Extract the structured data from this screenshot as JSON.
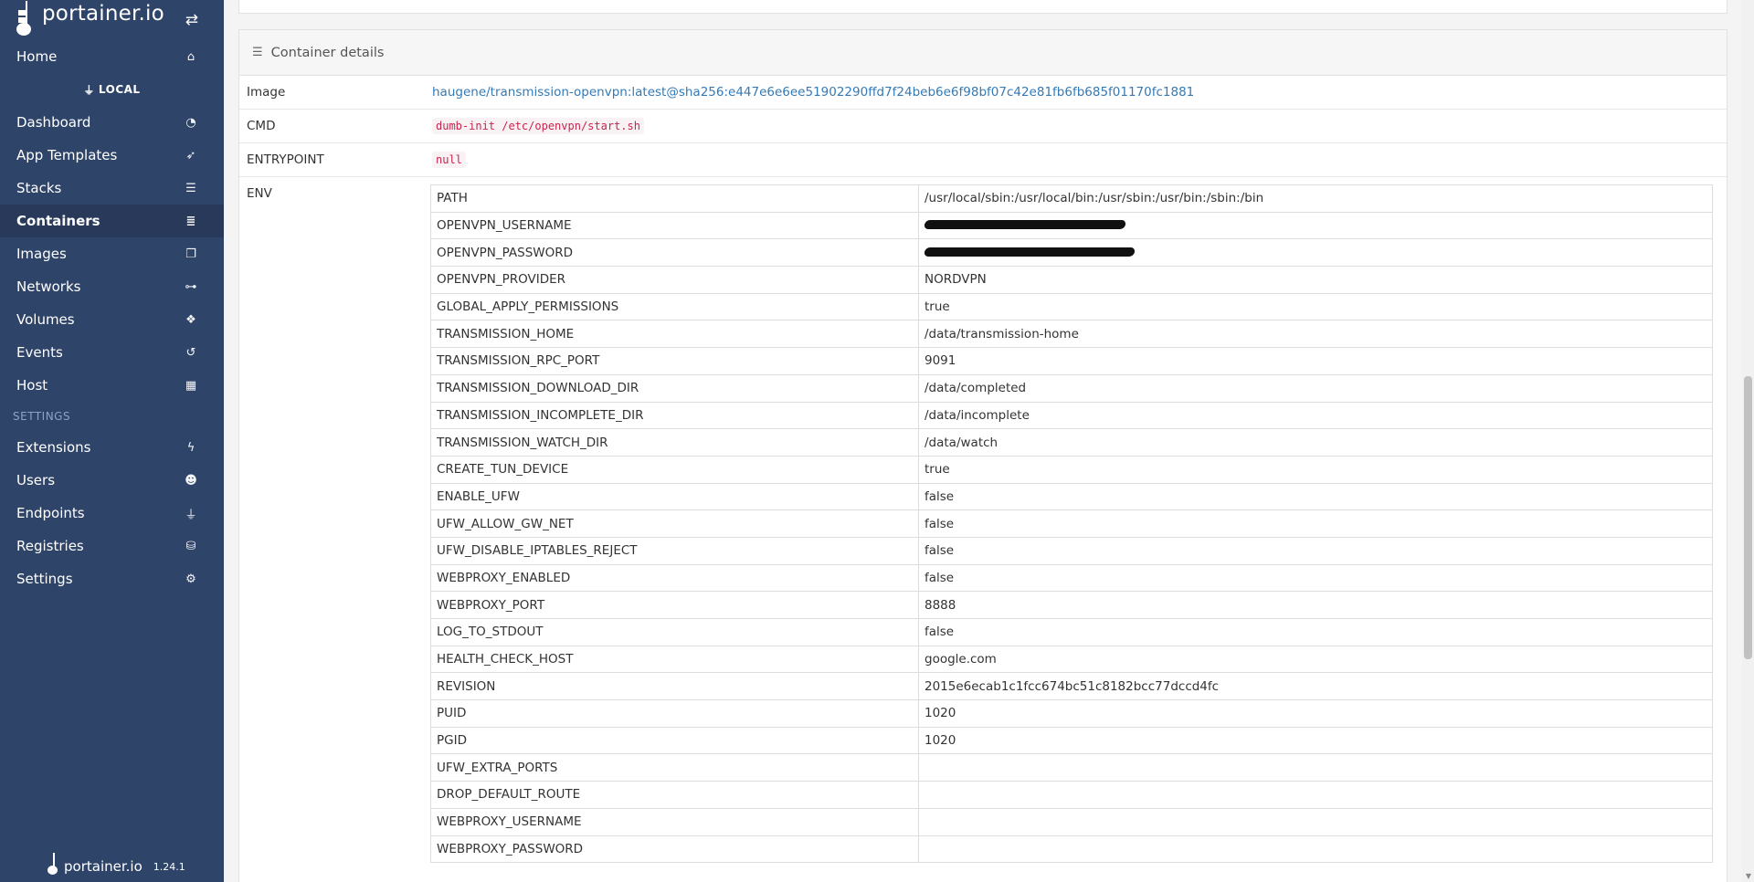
{
  "app": {
    "logo_text": "portainer.io",
    "version": "1.24.1"
  },
  "sidebar": {
    "home": "Home",
    "endpoint": "LOCAL",
    "items": [
      {
        "label": "Dashboard",
        "icon": "tachometer-icon"
      },
      {
        "label": "App Templates",
        "icon": "rocket-icon"
      },
      {
        "label": "Stacks",
        "icon": "th-list-icon"
      },
      {
        "label": "Containers",
        "icon": "server-icon",
        "active": true
      },
      {
        "label": "Images",
        "icon": "clone-icon"
      },
      {
        "label": "Networks",
        "icon": "sitemap-icon"
      },
      {
        "label": "Volumes",
        "icon": "cubes-icon"
      },
      {
        "label": "Events",
        "icon": "history-icon"
      },
      {
        "label": "Host",
        "icon": "th-icon"
      }
    ],
    "settings_label": "SETTINGS",
    "settings_items": [
      {
        "label": "Extensions",
        "icon": "bolt-icon"
      },
      {
        "label": "Users",
        "icon": "users-icon"
      },
      {
        "label": "Endpoints",
        "icon": "plug-icon"
      },
      {
        "label": "Registries",
        "icon": "database-icon"
      },
      {
        "label": "Settings",
        "icon": "cogs-icon"
      }
    ]
  },
  "panel": {
    "title": "Container details",
    "image_label": "Image",
    "image_value": "haugene/transmission-openvpn:latest@sha256:e447e6e6ee51902290ffd7f24beb6e6f98bf07c42e81fb6fb685f01170fc1881",
    "cmd_label": "CMD",
    "cmd_value": "dumb-init /etc/openvpn/start.sh",
    "entrypoint_label": "ENTRYPOINT",
    "entrypoint_value": "null",
    "env_label": "ENV"
  },
  "env": [
    {
      "key": "PATH",
      "value": "/usr/local/sbin:/usr/local/bin:/usr/sbin:/usr/bin:/sbin:/bin"
    },
    {
      "key": "OPENVPN_USERNAME",
      "value": "",
      "redacted": true
    },
    {
      "key": "OPENVPN_PASSWORD",
      "value": "",
      "redacted": true
    },
    {
      "key": "OPENVPN_PROVIDER",
      "value": "NORDVPN"
    },
    {
      "key": "GLOBAL_APPLY_PERMISSIONS",
      "value": "true"
    },
    {
      "key": "TRANSMISSION_HOME",
      "value": "/data/transmission-home"
    },
    {
      "key": "TRANSMISSION_RPC_PORT",
      "value": "9091"
    },
    {
      "key": "TRANSMISSION_DOWNLOAD_DIR",
      "value": "/data/completed"
    },
    {
      "key": "TRANSMISSION_INCOMPLETE_DIR",
      "value": "/data/incomplete"
    },
    {
      "key": "TRANSMISSION_WATCH_DIR",
      "value": "/data/watch"
    },
    {
      "key": "CREATE_TUN_DEVICE",
      "value": "true"
    },
    {
      "key": "ENABLE_UFW",
      "value": "false"
    },
    {
      "key": "UFW_ALLOW_GW_NET",
      "value": "false"
    },
    {
      "key": "UFW_DISABLE_IPTABLES_REJECT",
      "value": "false"
    },
    {
      "key": "WEBPROXY_ENABLED",
      "value": "false"
    },
    {
      "key": "WEBPROXY_PORT",
      "value": "8888"
    },
    {
      "key": "LOG_TO_STDOUT",
      "value": "false"
    },
    {
      "key": "HEALTH_CHECK_HOST",
      "value": "google.com"
    },
    {
      "key": "REVISION",
      "value": "2015e6ecab1c1fcc674bc51c8182bcc77dccd4fc"
    },
    {
      "key": "PUID",
      "value": "1020"
    },
    {
      "key": "PGID",
      "value": "1020"
    },
    {
      "key": "UFW_EXTRA_PORTS",
      "value": ""
    },
    {
      "key": "DROP_DEFAULT_ROUTE",
      "value": ""
    },
    {
      "key": "WEBPROXY_USERNAME",
      "value": ""
    },
    {
      "key": "WEBPROXY_PASSWORD",
      "value": ""
    }
  ]
}
